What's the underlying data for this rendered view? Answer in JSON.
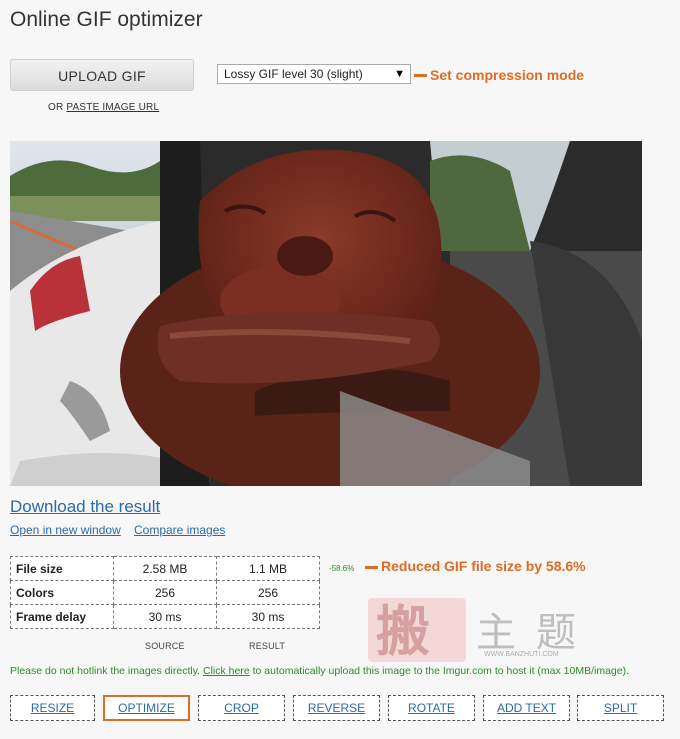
{
  "page": {
    "title": "Online GIF optimizer"
  },
  "upload": {
    "button_label": "UPLOAD GIF",
    "or_text": "OR",
    "paste_url_label": "PASTE IMAGE URL"
  },
  "compression": {
    "selected": "Lossy GIF level 30 (slight)"
  },
  "annotations": {
    "compression_note": "Set compression mode",
    "size_note": "Reduced GIF file size by 58.6%",
    "color": "#e06b22"
  },
  "result": {
    "download_label": "Download the result",
    "open_new_window": "Open in new window",
    "compare_images": "Compare images"
  },
  "stats": {
    "rows": [
      {
        "label": "File size",
        "source": "2.58 MB",
        "result": "1.1 MB"
      },
      {
        "label": "Colors",
        "source": "256",
        "result": "256"
      },
      {
        "label": "Frame delay",
        "source": "30 ms",
        "result": "30 ms"
      }
    ],
    "source_label": "SOURCE",
    "result_label": "RESULT",
    "reduction": "-58.6%"
  },
  "notice": {
    "before": "Please do not hotlink the images directly.",
    "link": "Click here",
    "after": "to automatically upload this image to the Imgur.com to host it (max 10MB/image)."
  },
  "watermark": {
    "chars": "搬主题",
    "url": "WWW.BANZHUTI.COM"
  },
  "tools": [
    "RESIZE",
    "OPTIMIZE",
    "CROP",
    "REVERSE",
    "ROTATE",
    "ADD TEXT",
    "SPLIT"
  ],
  "active_tool": "OPTIMIZE",
  "colors": {
    "link": "#2a6aa8",
    "notice_green": "#2e8a2e",
    "accent": "#e06b22"
  }
}
